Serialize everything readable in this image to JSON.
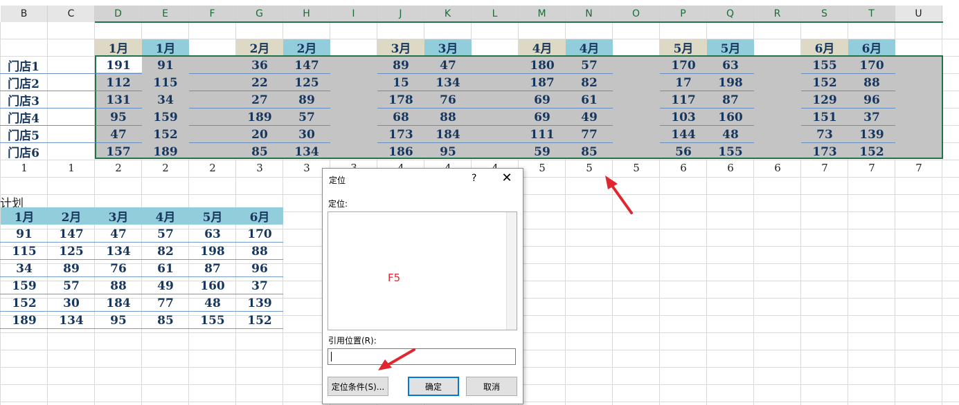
{
  "columns": [
    "B",
    "C",
    "D",
    "E",
    "F",
    "G",
    "H",
    "I",
    "J",
    "K",
    "L",
    "M",
    "N",
    "O",
    "P",
    "Q",
    "R",
    "S",
    "T",
    "U"
  ],
  "months": [
    "1月",
    "1月",
    "2月",
    "2月",
    "3月",
    "3月",
    "4月",
    "4月",
    "5月",
    "5月",
    "6月",
    "6月"
  ],
  "stores": [
    "门店1",
    "门店2",
    "门店3",
    "门店4",
    "门店5",
    "门店6"
  ],
  "table_rows": [
    [
      "191",
      "91",
      "",
      "36",
      "147",
      "",
      "89",
      "47",
      "",
      "180",
      "57",
      "",
      "170",
      "63",
      "",
      "155",
      "170"
    ],
    [
      "112",
      "115",
      "",
      "22",
      "125",
      "",
      "15",
      "134",
      "",
      "187",
      "82",
      "",
      "17",
      "198",
      "",
      "152",
      "88"
    ],
    [
      "131",
      "34",
      "",
      "27",
      "89",
      "",
      "178",
      "76",
      "",
      "69",
      "61",
      "",
      "117",
      "87",
      "",
      "129",
      "96"
    ],
    [
      "95",
      "159",
      "",
      "189",
      "57",
      "",
      "68",
      "88",
      "",
      "69",
      "49",
      "",
      "103",
      "160",
      "",
      "151",
      "37"
    ],
    [
      "47",
      "152",
      "",
      "20",
      "30",
      "",
      "173",
      "184",
      "",
      "111",
      "77",
      "",
      "144",
      "48",
      "",
      "73",
      "139"
    ],
    [
      "157",
      "189",
      "",
      "85",
      "134",
      "",
      "186",
      "95",
      "",
      "59",
      "85",
      "",
      "56",
      "155",
      "",
      "173",
      "152"
    ]
  ],
  "index_row": [
    "1",
    "1",
    "2",
    "2",
    "2",
    "3",
    "3",
    "3",
    "4",
    "4",
    "4",
    "5",
    "5",
    "5",
    "6",
    "6",
    "6",
    "7",
    "7",
    "7"
  ],
  "plan": {
    "title": "计划",
    "headers": [
      "1月",
      "2月",
      "3月",
      "4月",
      "5月",
      "6月"
    ],
    "rows": [
      [
        "91",
        "147",
        "47",
        "57",
        "63",
        "170"
      ],
      [
        "115",
        "125",
        "134",
        "82",
        "198",
        "88"
      ],
      [
        "34",
        "89",
        "76",
        "61",
        "87",
        "96"
      ],
      [
        "159",
        "57",
        "88",
        "49",
        "160",
        "37"
      ],
      [
        "152",
        "30",
        "184",
        "77",
        "48",
        "139"
      ],
      [
        "189",
        "134",
        "95",
        "85",
        "155",
        "152"
      ]
    ]
  },
  "dialog": {
    "title": "定位",
    "help": "?",
    "close": "✕",
    "goto_label": "定位:",
    "annotation": "F5",
    "reference_label": "引用位置(R):",
    "reference_value": "",
    "special_button": "定位条件(S)...",
    "ok_button": "确定",
    "cancel_button": "取消"
  },
  "colors": {
    "selection": "#c4c4c4",
    "accent": "#217346",
    "month_tan": "#ddd9c4",
    "month_blue": "#92cddc",
    "arrow": "#e0262e"
  }
}
